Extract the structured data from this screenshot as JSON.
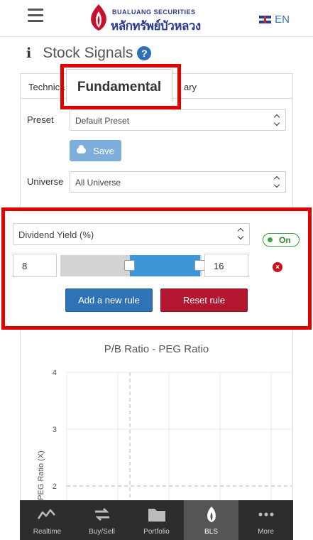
{
  "header": {
    "brand_en": "BUALUANG SECURITIES",
    "brand_th": "หลักทรัพย์บัวหลวง",
    "language": "EN"
  },
  "page": {
    "title": "Stock Signals",
    "info_icon": "i",
    "help_icon": "?"
  },
  "tabs": [
    {
      "label": "Technica"
    },
    {
      "label": "Fundamental"
    },
    {
      "label": "ary"
    }
  ],
  "form": {
    "preset_label": "Preset",
    "preset_value": "Default Preset",
    "save_label": "Save",
    "universe_label": "Universe",
    "universe_value": "All Universe"
  },
  "rule": {
    "metric": "Dividend Yield (%)",
    "toggle_label": "On",
    "min_value": "8",
    "max_value": "16",
    "slider_range": {
      "low_fraction": 0.49,
      "high_fraction": 0.99
    },
    "add_rule_label": "Add a new rule",
    "reset_rule_label": "Reset rule",
    "remove_icon": "×"
  },
  "chart_data": {
    "type": "scatter",
    "title": "P/B Ratio - PEG Ratio",
    "ylabel": "PEG Ratio (X)",
    "xlabel": "",
    "yticks": [
      "4",
      "3",
      "2"
    ],
    "ylim": [
      1.5,
      4
    ],
    "grid": true,
    "series": []
  },
  "bottom_nav": [
    {
      "label": "Realtime",
      "icon": "chart-line-icon"
    },
    {
      "label": "Buy/Sell",
      "icon": "arrows-exchange-icon"
    },
    {
      "label": "Portfolio",
      "icon": "folder-icon"
    },
    {
      "label": "BLS",
      "icon": "lotus-icon"
    },
    {
      "label": "More",
      "icon": "more-dots-icon"
    }
  ],
  "colors": {
    "highlight": "#e00000",
    "primary": "#2f73b7",
    "danger": "#b3162f",
    "slider_fill": "#3c96d8",
    "toggle_on": "#3a9c3a",
    "nav_bg": "#2d2d2d"
  }
}
